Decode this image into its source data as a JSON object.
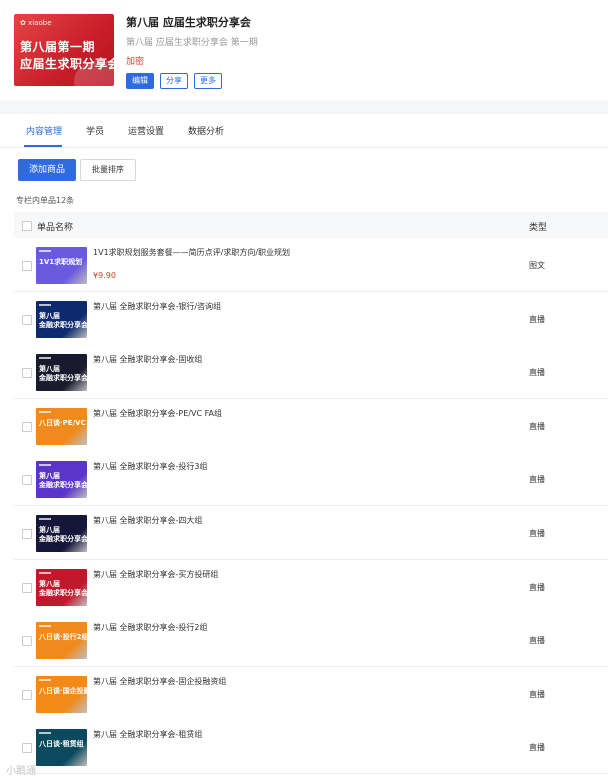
{
  "header": {
    "cover_brand": "✿ xiaobe",
    "cover_line1": "第八届第一期",
    "cover_line2": "应届生求职分享会",
    "title": "第八届 应届生求职分享会",
    "subtitle": "第八届 应届生求职分享会 第一期",
    "status": "加密",
    "buttons": [
      "编辑",
      "分享",
      "更多"
    ]
  },
  "tabs": [
    "内容管理",
    "学员",
    "运营设置",
    "数据分析"
  ],
  "toolbar": {
    "add_label": "添加商品",
    "sort_label": "批量排序"
  },
  "count_text": "专栏内单品12条",
  "table": {
    "col_name": "单品名称",
    "col_type": "类型",
    "rows": [
      {
        "name": "1V1求职规划服务套餐——简历点评/求职方向/职业规划",
        "price": "¥9.90",
        "type": "图文",
        "thumb_text": "1V1求职规划",
        "thumb_color": "#6a5ae0"
      },
      {
        "name": "第八届 全融求职分享会-银行/咨询组",
        "price": "",
        "type": "直播",
        "thumb_text": "第八届\n金融求职分享会",
        "thumb_color": "#0e2a6e"
      },
      {
        "name": "第八届 全融求职分享会-固收组",
        "price": "",
        "type": "直播",
        "thumb_text": "第八届\n金融求职分享会",
        "thumb_color": "#1a1a2e"
      },
      {
        "name": "第八届 全融求职分享会-PE/VC FA组",
        "price": "",
        "type": "直播",
        "thumb_text": "八日谈·PE/VC FA组",
        "thumb_color": "#f08a1c"
      },
      {
        "name": "第八届 全融求职分享会-投行3组",
        "price": "",
        "type": "直播",
        "thumb_text": "第八届\n金融求职分享会",
        "thumb_color": "#5b35c9"
      },
      {
        "name": "第八届 全融求职分享会-四大组",
        "price": "",
        "type": "直播",
        "thumb_text": "第八届\n金融求职分享会",
        "thumb_color": "#14163a"
      },
      {
        "name": "第八届 全融求职分享会-买方投研组",
        "price": "",
        "type": "直播",
        "thumb_text": "第八届\n金融求职分享会",
        "thumb_color": "#c2182b"
      },
      {
        "name": "第八届 全融求职分享会-投行2组",
        "price": "",
        "type": "直播",
        "thumb_text": "八日谈·投行2组",
        "thumb_color": "#f08a1c"
      },
      {
        "name": "第八届 全融求职分享会-固企投融资组",
        "price": "",
        "type": "直播",
        "thumb_text": "八日谈·国企投融资",
        "thumb_color": "#f28a1a"
      },
      {
        "name": "第八届 全融求职分享会-租赁组",
        "price": "",
        "type": "直播",
        "thumb_text": "八日谈·租赁组",
        "thumb_color": "#0b4a5e"
      }
    ]
  },
  "watermark": "小鹅通"
}
